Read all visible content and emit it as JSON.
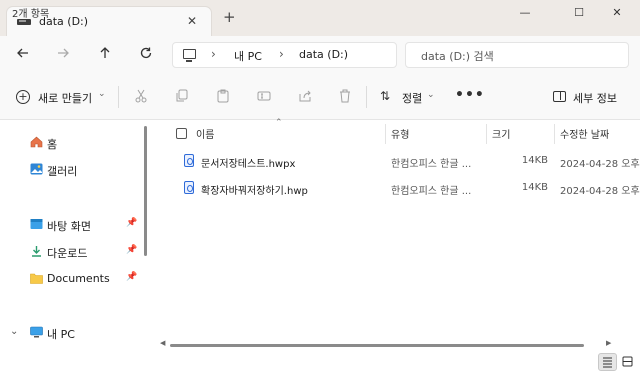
{
  "window": {
    "tab_title": "data (D:)",
    "tab_close": "✕",
    "new_tab": "+",
    "minimize": "—",
    "maximize": "☐",
    "close": "✕"
  },
  "address": {
    "breadcrumbs": [
      {
        "label": "내 PC"
      },
      {
        "label": "data (D:)"
      }
    ],
    "search_placeholder": "data (D:) 검색"
  },
  "toolbar": {
    "new_label": "새로 만들기",
    "sort_label": "정렬",
    "more": "•••",
    "details_label": "세부 정보",
    "icons": [
      "cut-icon",
      "copy-icon",
      "paste-icon",
      "rename-icon",
      "share-icon",
      "delete-icon"
    ]
  },
  "sidebar": {
    "items": [
      {
        "label": "홈",
        "icon": "home-icon"
      },
      {
        "label": "갤러리",
        "icon": "gallery-icon"
      },
      {
        "label": "바탕 화면",
        "icon": "desktop-folder-icon",
        "pinned": true
      },
      {
        "label": "다운로드",
        "icon": "download-folder-icon",
        "pinned": true
      },
      {
        "label": "Documents",
        "icon": "documents-folder-icon",
        "pinned": true
      },
      {
        "label": "내 PC",
        "icon": "pc-icon",
        "expanded": true
      }
    ]
  },
  "file_list": {
    "columns": [
      "이름",
      "유형",
      "크기",
      "수정한 날짜"
    ],
    "rows": [
      {
        "name": "문서저장테스트.hwpx",
        "type": "한컴오피스 한글 ...",
        "size": "14KB",
        "date": "2024-04-28 오후"
      },
      {
        "name": "확장자바꿔저장하기.hwp",
        "type": "한컴오피스 한글 ...",
        "size": "14KB",
        "date": "2024-04-28 오후"
      }
    ]
  },
  "status": {
    "item_count": "2개 항목"
  },
  "colors": {
    "accent": "#0067c0",
    "titlebar": "#eeeae6",
    "chrome": "#f9f9f9"
  }
}
